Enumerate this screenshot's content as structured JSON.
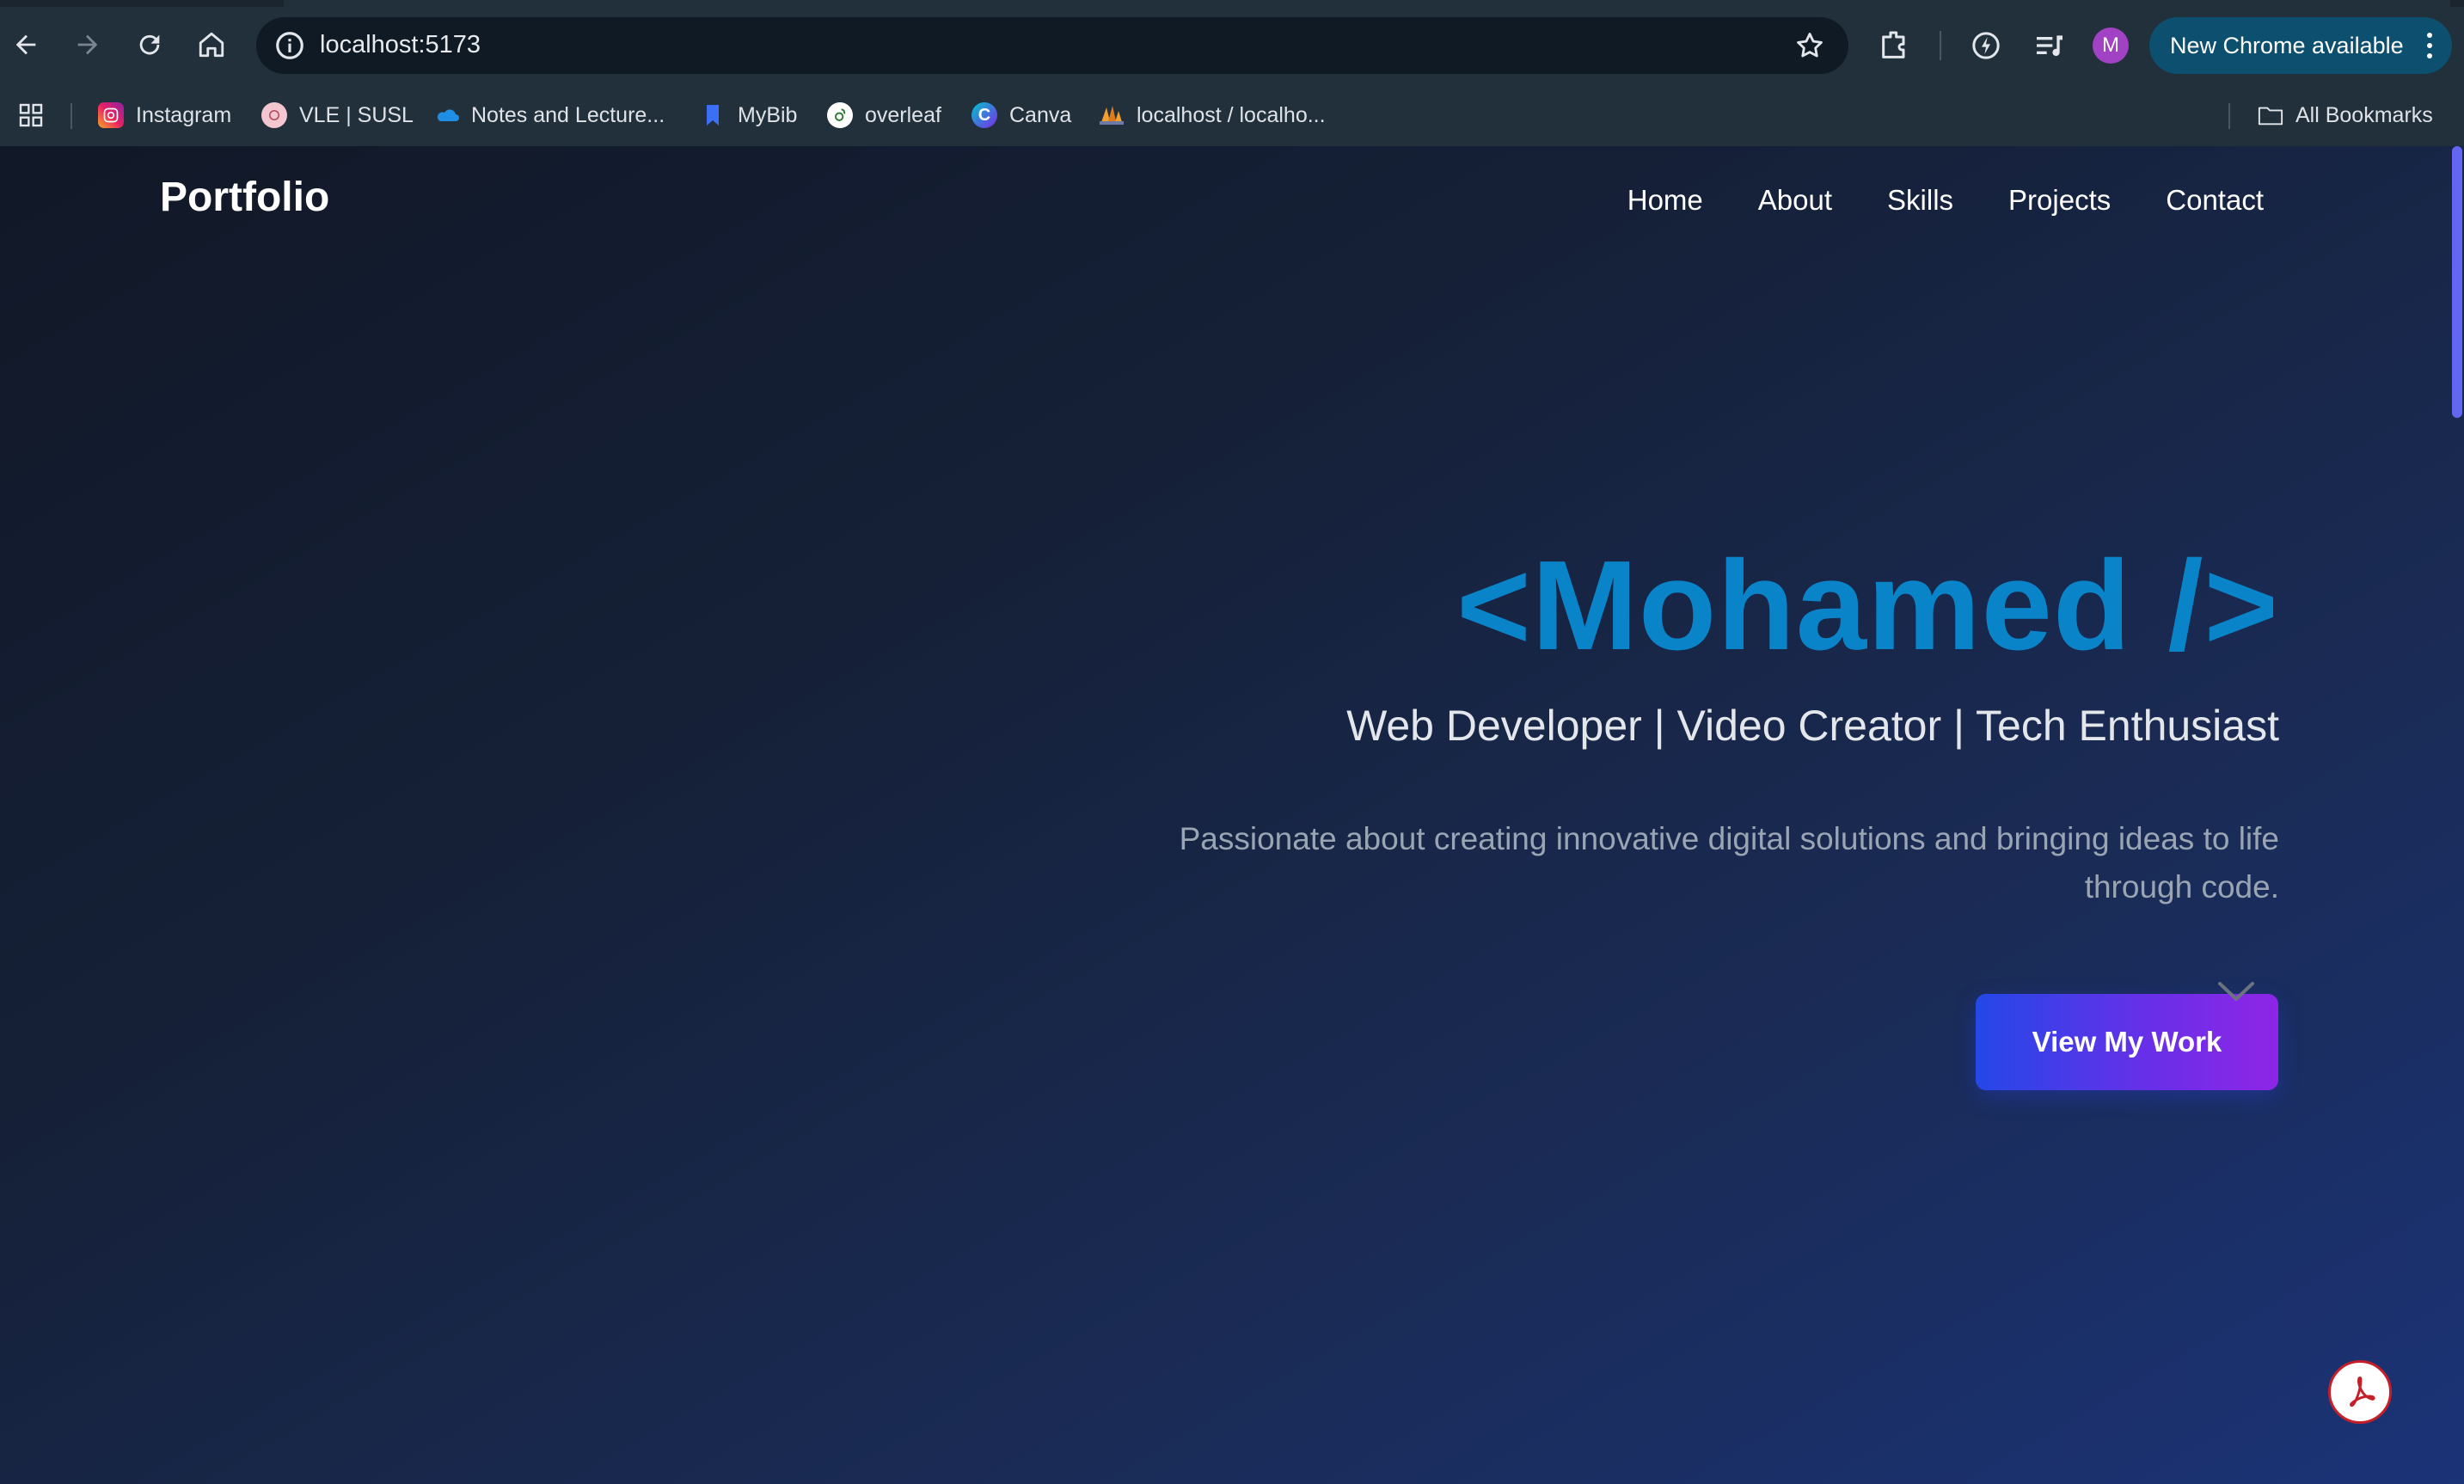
{
  "browser": {
    "address_url": "localhost:5173",
    "update_button_label": "New Chrome available",
    "profile_initial": "M",
    "bookmarks": [
      {
        "label": "Instagram",
        "icon": "instagram-icon"
      },
      {
        "label": "VLE | SUSL",
        "icon": "vle-icon"
      },
      {
        "label": "Notes and Lecture...",
        "icon": "onedrive-icon"
      },
      {
        "label": "MyBib",
        "icon": "bookmark-icon"
      },
      {
        "label": "overleaf",
        "icon": "overleaf-icon"
      },
      {
        "label": "Canva",
        "icon": "canva-icon"
      },
      {
        "label": "localhost / localho...",
        "icon": "phpmyadmin-icon"
      }
    ],
    "all_bookmarks_label": "All Bookmarks"
  },
  "site": {
    "brand": "Portfolio",
    "nav": [
      "Home",
      "About",
      "Skills",
      "Projects",
      "Contact"
    ],
    "hero": {
      "title": "<Mohamed />",
      "subtitle": "Web Developer | Video Creator | Tech Enthusiast",
      "description": "Passionate about creating innovative digital solutions and bringing ideas to life through code.",
      "cta_label": "View My Work"
    }
  },
  "colors": {
    "accent_title": "#0a84c9",
    "cta_gradient_start": "#2448e8",
    "cta_gradient_end": "#8e26e6",
    "page_bg_top": "#111827",
    "page_bg_bottom": "#1b3377"
  }
}
